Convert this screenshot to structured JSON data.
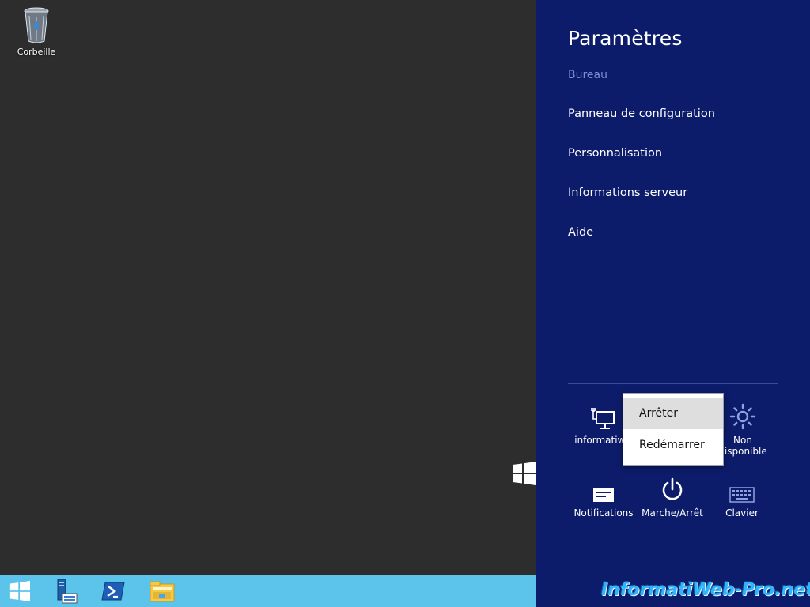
{
  "desktop": {
    "recycle_bin_label": "Corbeille"
  },
  "taskbar": {
    "items": [
      "start-icon",
      "server-manager-icon",
      "powershell-icon",
      "file-explorer-icon"
    ]
  },
  "charm": {
    "title": "Paramètres",
    "context": "Bureau",
    "links": [
      "Panneau de configuration",
      "Personnalisation",
      "Informations serveur",
      "Aide"
    ],
    "tiles": {
      "network": "informatiwe",
      "brightness_line1": "Non",
      "brightness_line2": "disponible",
      "notifications": "Notifications",
      "power": "Marche/Arrêt",
      "keyboard": "Clavier"
    }
  },
  "power_menu": {
    "shutdown": "Arrêter",
    "restart": "Redémarrer"
  },
  "watermark": "InformatiWeb-Pro.net",
  "colors": {
    "charm_bg": "#0d1c6a",
    "taskbar_bg": "#5cc4eb",
    "desktop_bg": "#2d2d2d"
  }
}
